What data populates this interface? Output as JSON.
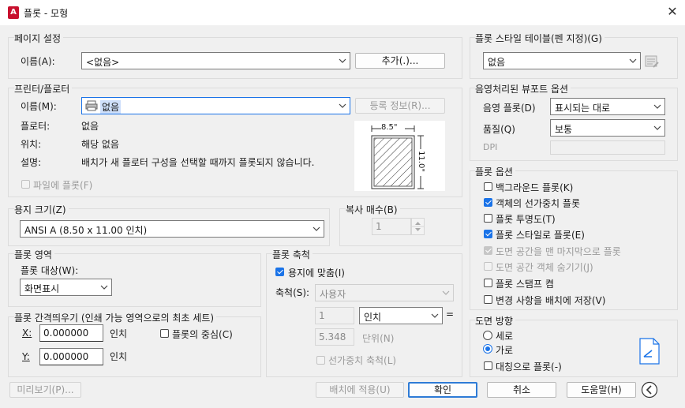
{
  "window": {
    "title": "플롯 - 모형",
    "app_icon": "A",
    "close": "✕"
  },
  "page_setup": {
    "group_title": "페이지 설정",
    "name_label": "이름(A):",
    "name_value": "<없음>",
    "add_button": "추가(.)..."
  },
  "printer": {
    "group_title": "프린터/플로터",
    "name_label": "이름(M):",
    "name_value": "없음",
    "properties_button": "등록 정보(R)...",
    "plotter_label": "플로터:",
    "plotter_value": "없음",
    "location_label": "위치:",
    "location_value": "해당 없음",
    "description_label": "설명:",
    "description_value": "배치가 새 플로터 구성을 선택할 때까지 플롯되지 않습니다.",
    "plot_to_file_label": "파일에 플롯(F)",
    "preview_width": "8.5\"",
    "preview_height": "11.0\""
  },
  "paper_size": {
    "group_title": "용지 크기(Z)",
    "value": "ANSI A (8.50 x 11.00 인치)"
  },
  "copies": {
    "group_title": "복사 매수(B)",
    "value": "1"
  },
  "plot_area": {
    "group_title": "플롯 영역",
    "what_label": "플롯 대상(W):",
    "what_value": "화면표시"
  },
  "plot_offset": {
    "group_title": "플롯 간격띄우기 (인쇄 가능 영역으로의 최초 세트)",
    "x_label": "X:",
    "x_value": "0.000000",
    "x_unit": "인치",
    "y_label": "Y:",
    "y_value": "0.000000",
    "y_unit": "인치",
    "center_label": "플롯의 중심(C)"
  },
  "plot_scale": {
    "group_title": "플롯 축척",
    "fit_label": "용지에 맞춤(I)",
    "scale_label": "축척(S):",
    "scale_value": "사용자",
    "value1": "1",
    "unit_value": "인치",
    "equals": "=",
    "value2": "5.348",
    "units_label": "단위(N)",
    "lineweights_label": "선가중치 축척(L)"
  },
  "plot_style_table": {
    "group_title": "플롯 스타일 테이블(펜 지정)(G)",
    "value": "없음"
  },
  "shaded_viewport": {
    "group_title": "음영처리된 뷰포트 옵션",
    "shade_label": "음영 플롯(D)",
    "shade_value": "표시되는 대로",
    "quality_label": "품질(Q)",
    "quality_value": "보통",
    "dpi_label": "DPI"
  },
  "plot_options": {
    "group_title": "플롯 옵션",
    "items": [
      {
        "label": "백그라운드 플롯(K)",
        "state": "off"
      },
      {
        "label": "객체의 선가중치 플롯",
        "state": "on"
      },
      {
        "label": "플롯 투명도(T)",
        "state": "off"
      },
      {
        "label": "플롯 스타일로 플롯(E)",
        "state": "on"
      },
      {
        "label": "도면 공간을 맨 마지막으로 플롯",
        "state": "disabled-on"
      },
      {
        "label": "도면 공간 객체 숨기기(J)",
        "state": "disabled-off"
      },
      {
        "label": "플롯 스탬프 켬",
        "state": "off"
      },
      {
        "label": "변경 사항을 배치에 저장(V)",
        "state": "off"
      }
    ]
  },
  "orientation": {
    "group_title": "도면 방향",
    "portrait_label": "세로",
    "landscape_label": "가로",
    "upside_down_label": "대칭으로 플롯(-)",
    "selected": "가로"
  },
  "footer": {
    "preview_button": "미리보기(P)...",
    "apply_button": "배치에 적용(U)",
    "ok_button": "확인",
    "cancel_button": "취소",
    "help_button": "도움말(H)"
  },
  "colors": {
    "accent": "#1a73e8",
    "brand": "#c8102e"
  }
}
